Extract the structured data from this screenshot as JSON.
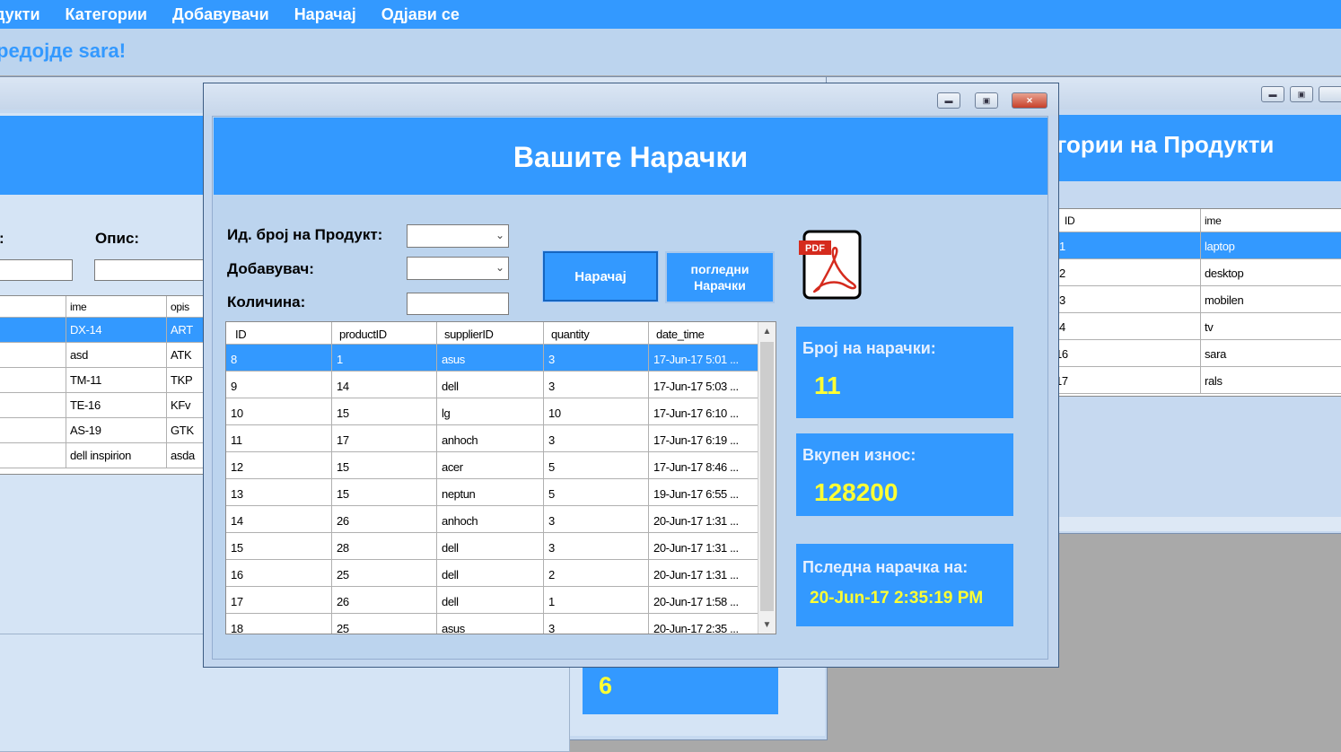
{
  "menu": {
    "items": [
      "дукти",
      "Категории",
      "Добавувачи",
      "Нарачај",
      "Одјави се"
    ]
  },
  "welcome": "редојде  sara!",
  "left_window": {
    "label_code": ":",
    "label_desc": "Опис:",
    "columns": [
      "",
      "ime",
      "opis"
    ],
    "rows": [
      [
        "",
        "DX-14",
        "ART"
      ],
      [
        "",
        "asd",
        "ATK"
      ],
      [
        "",
        "TM-11",
        "TKP"
      ],
      [
        "",
        "TE-16",
        "KFv"
      ],
      [
        "",
        "AS-19",
        "GTK"
      ],
      [
        "",
        "dell inspirion",
        "asda"
      ]
    ],
    "count_value": "6"
  },
  "right_window": {
    "title": "егории на Продукти",
    "columns": [
      "ID",
      "ime"
    ],
    "rows": [
      [
        "1",
        "laptop"
      ],
      [
        "2",
        "desktop"
      ],
      [
        "3",
        "mobilen"
      ],
      [
        "4",
        "tv"
      ],
      [
        "16",
        "sara"
      ],
      [
        "17",
        "rals"
      ]
    ]
  },
  "dialog": {
    "title": "Вашите Нарачки",
    "label_product": "Ид. број на Продукт:",
    "label_supplier": "Добавувач:",
    "label_quantity": "Количина:",
    "button_order": "Нарачај",
    "button_view": "погледни Нарачки",
    "icon_pdf": "pdf-icon",
    "pdf_badge": "PDF",
    "stats": {
      "count_label": "Број на нарачки:",
      "count_value": "11",
      "total_label": "Вкупен износ:",
      "total_value": "128200",
      "last_label": "Пследна нарачка на:",
      "last_value": "20-Jun-17 2:35:19 PM"
    },
    "orders": {
      "columns": [
        "ID",
        "productID",
        "supplierID",
        "quantity",
        "date_time"
      ],
      "rows": [
        [
          "8",
          "1",
          "asus",
          "3",
          "17-Jun-17 5:01 ..."
        ],
        [
          "9",
          "14",
          "dell",
          "3",
          "17-Jun-17 5:03 ..."
        ],
        [
          "10",
          "15",
          "lg",
          "10",
          "17-Jun-17 6:10 ..."
        ],
        [
          "11",
          "17",
          "anhoch",
          "3",
          "17-Jun-17 6:19 ..."
        ],
        [
          "12",
          "15",
          "acer",
          "5",
          "17-Jun-17 8:46 ..."
        ],
        [
          "13",
          "15",
          "neptun",
          "5",
          "19-Jun-17 6:55 ..."
        ],
        [
          "14",
          "26",
          "anhoch",
          "3",
          "20-Jun-17 1:31 ..."
        ],
        [
          "15",
          "28",
          "dell",
          "3",
          "20-Jun-17 1:31 ..."
        ],
        [
          "16",
          "25",
          "dell",
          "2",
          "20-Jun-17 1:31 ..."
        ],
        [
          "17",
          "26",
          "dell",
          "1",
          "20-Jun-17 1:58 ..."
        ],
        [
          "18",
          "25",
          "asus",
          "3",
          "20-Jun-17 2:35 ..."
        ]
      ],
      "selected_row": 0
    }
  },
  "colors": {
    "accent": "#3399ff",
    "highlight_value": "#ffff33",
    "background": "#bcd4ee"
  }
}
